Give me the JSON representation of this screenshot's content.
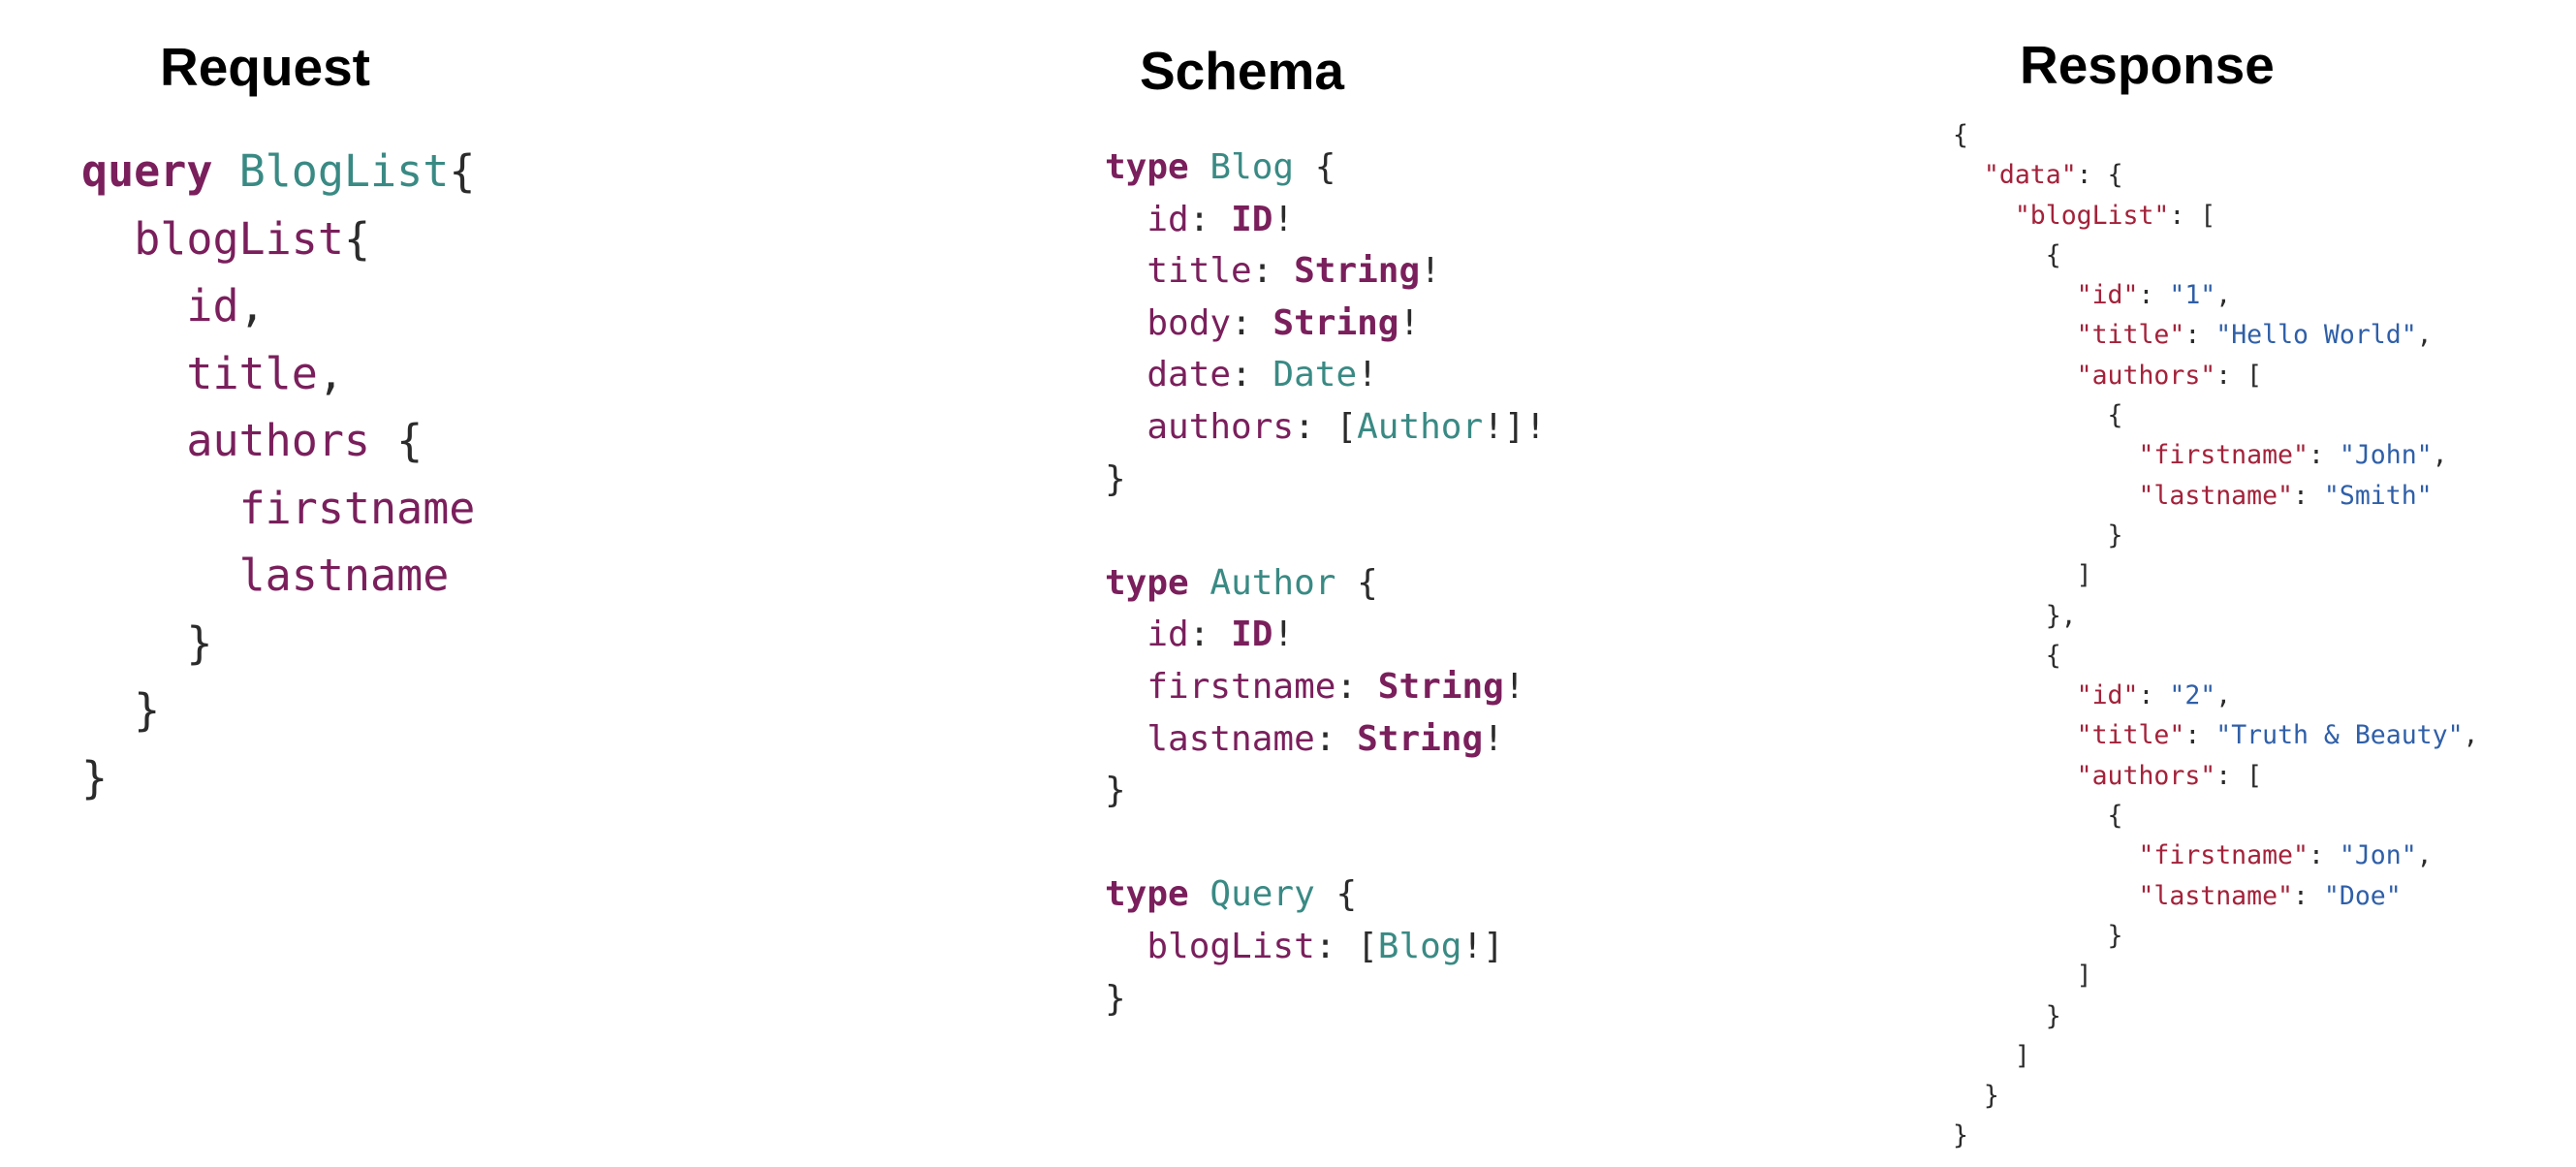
{
  "colors": {
    "keyword": "#7a1f5c",
    "type_name": "#3a8a84",
    "field": "#7a1f5c",
    "punctuation": "#2b2b2b",
    "json_key": "#a3223a",
    "json_string": "#2f5fa8",
    "title_text": "#000000"
  },
  "panels": [
    {
      "name": "request",
      "title": "Request",
      "lines": [
        [
          {
            "t": "query",
            "c": "keyword",
            "bold": true
          },
          {
            "t": " ",
            "c": "punctuation"
          },
          {
            "t": "BlogList",
            "c": "type_name"
          },
          {
            "t": "{",
            "c": "punctuation"
          }
        ],
        [
          {
            "t": "  ",
            "c": "punctuation"
          },
          {
            "t": "blogList",
            "c": "field"
          },
          {
            "t": "{",
            "c": "punctuation"
          }
        ],
        [
          {
            "t": "    ",
            "c": "punctuation"
          },
          {
            "t": "id",
            "c": "field"
          },
          {
            "t": ",",
            "c": "punctuation"
          }
        ],
        [
          {
            "t": "    ",
            "c": "punctuation"
          },
          {
            "t": "title",
            "c": "field"
          },
          {
            "t": ",",
            "c": "punctuation"
          }
        ],
        [
          {
            "t": "    ",
            "c": "punctuation"
          },
          {
            "t": "authors",
            "c": "field"
          },
          {
            "t": " {",
            "c": "punctuation"
          }
        ],
        [
          {
            "t": "      ",
            "c": "punctuation"
          },
          {
            "t": "firstname",
            "c": "field"
          }
        ],
        [
          {
            "t": "      ",
            "c": "punctuation"
          },
          {
            "t": "lastname",
            "c": "field"
          }
        ],
        [
          {
            "t": "    }",
            "c": "punctuation"
          }
        ],
        [
          {
            "t": "  }",
            "c": "punctuation"
          }
        ],
        [
          {
            "t": "}",
            "c": "punctuation"
          }
        ]
      ]
    },
    {
      "name": "schema",
      "title": "Schema",
      "lines": [
        [
          {
            "t": "type",
            "c": "keyword",
            "bold": true
          },
          {
            "t": " ",
            "c": "punctuation"
          },
          {
            "t": "Blog",
            "c": "type_name"
          },
          {
            "t": " {",
            "c": "punctuation"
          }
        ],
        [
          {
            "t": "  ",
            "c": "punctuation"
          },
          {
            "t": "id",
            "c": "field"
          },
          {
            "t": ": ",
            "c": "punctuation"
          },
          {
            "t": "ID",
            "c": "keyword",
            "bold": true
          },
          {
            "t": "!",
            "c": "punctuation"
          }
        ],
        [
          {
            "t": "  ",
            "c": "punctuation"
          },
          {
            "t": "title",
            "c": "field"
          },
          {
            "t": ": ",
            "c": "punctuation"
          },
          {
            "t": "String",
            "c": "keyword",
            "bold": true
          },
          {
            "t": "!",
            "c": "punctuation"
          }
        ],
        [
          {
            "t": "  ",
            "c": "punctuation"
          },
          {
            "t": "body",
            "c": "field"
          },
          {
            "t": ": ",
            "c": "punctuation"
          },
          {
            "t": "String",
            "c": "keyword",
            "bold": true
          },
          {
            "t": "!",
            "c": "punctuation"
          }
        ],
        [
          {
            "t": "  ",
            "c": "punctuation"
          },
          {
            "t": "date",
            "c": "field"
          },
          {
            "t": ": ",
            "c": "punctuation"
          },
          {
            "t": "Date",
            "c": "type_name"
          },
          {
            "t": "!",
            "c": "punctuation"
          }
        ],
        [
          {
            "t": "  ",
            "c": "punctuation"
          },
          {
            "t": "authors",
            "c": "field"
          },
          {
            "t": ": [",
            "c": "punctuation"
          },
          {
            "t": "Author",
            "c": "type_name"
          },
          {
            "t": "!]!",
            "c": "punctuation"
          }
        ],
        [
          {
            "t": "}",
            "c": "punctuation"
          }
        ],
        [
          {
            "t": "",
            "c": "punctuation"
          }
        ],
        [
          {
            "t": "type",
            "c": "keyword",
            "bold": true
          },
          {
            "t": " ",
            "c": "punctuation"
          },
          {
            "t": "Author",
            "c": "type_name"
          },
          {
            "t": " {",
            "c": "punctuation"
          }
        ],
        [
          {
            "t": "  ",
            "c": "punctuation"
          },
          {
            "t": "id",
            "c": "field"
          },
          {
            "t": ": ",
            "c": "punctuation"
          },
          {
            "t": "ID",
            "c": "keyword",
            "bold": true
          },
          {
            "t": "!",
            "c": "punctuation"
          }
        ],
        [
          {
            "t": "  ",
            "c": "punctuation"
          },
          {
            "t": "firstname",
            "c": "field"
          },
          {
            "t": ": ",
            "c": "punctuation"
          },
          {
            "t": "String",
            "c": "keyword",
            "bold": true
          },
          {
            "t": "!",
            "c": "punctuation"
          }
        ],
        [
          {
            "t": "  ",
            "c": "punctuation"
          },
          {
            "t": "lastname",
            "c": "field"
          },
          {
            "t": ": ",
            "c": "punctuation"
          },
          {
            "t": "String",
            "c": "keyword",
            "bold": true
          },
          {
            "t": "!",
            "c": "punctuation"
          }
        ],
        [
          {
            "t": "}",
            "c": "punctuation"
          }
        ],
        [
          {
            "t": "",
            "c": "punctuation"
          }
        ],
        [
          {
            "t": "type",
            "c": "keyword",
            "bold": true
          },
          {
            "t": " ",
            "c": "punctuation"
          },
          {
            "t": "Query",
            "c": "type_name"
          },
          {
            "t": " {",
            "c": "punctuation"
          }
        ],
        [
          {
            "t": "  ",
            "c": "punctuation"
          },
          {
            "t": "blogList",
            "c": "field"
          },
          {
            "t": ": [",
            "c": "punctuation"
          },
          {
            "t": "Blog",
            "c": "type_name"
          },
          {
            "t": "!]",
            "c": "punctuation"
          }
        ],
        [
          {
            "t": "}",
            "c": "punctuation"
          }
        ]
      ]
    },
    {
      "name": "response",
      "title": "Response",
      "lines": [
        [
          {
            "t": "{",
            "c": "punctuation"
          }
        ],
        [
          {
            "t": "  ",
            "c": "punctuation"
          },
          {
            "t": "\"data\"",
            "c": "json_key"
          },
          {
            "t": ": {",
            "c": "punctuation"
          }
        ],
        [
          {
            "t": "    ",
            "c": "punctuation"
          },
          {
            "t": "\"blogList\"",
            "c": "json_key"
          },
          {
            "t": ": [",
            "c": "punctuation"
          }
        ],
        [
          {
            "t": "      {",
            "c": "punctuation"
          }
        ],
        [
          {
            "t": "        ",
            "c": "punctuation"
          },
          {
            "t": "\"id\"",
            "c": "json_key"
          },
          {
            "t": ": ",
            "c": "punctuation"
          },
          {
            "t": "\"1\"",
            "c": "json_string"
          },
          {
            "t": ",",
            "c": "punctuation"
          }
        ],
        [
          {
            "t": "        ",
            "c": "punctuation"
          },
          {
            "t": "\"title\"",
            "c": "json_key"
          },
          {
            "t": ": ",
            "c": "punctuation"
          },
          {
            "t": "\"Hello World\"",
            "c": "json_string"
          },
          {
            "t": ",",
            "c": "punctuation"
          }
        ],
        [
          {
            "t": "        ",
            "c": "punctuation"
          },
          {
            "t": "\"authors\"",
            "c": "json_key"
          },
          {
            "t": ": [",
            "c": "punctuation"
          }
        ],
        [
          {
            "t": "          {",
            "c": "punctuation"
          }
        ],
        [
          {
            "t": "            ",
            "c": "punctuation"
          },
          {
            "t": "\"firstname\"",
            "c": "json_key"
          },
          {
            "t": ": ",
            "c": "punctuation"
          },
          {
            "t": "\"John\"",
            "c": "json_string"
          },
          {
            "t": ",",
            "c": "punctuation"
          }
        ],
        [
          {
            "t": "            ",
            "c": "punctuation"
          },
          {
            "t": "\"lastname\"",
            "c": "json_key"
          },
          {
            "t": ": ",
            "c": "punctuation"
          },
          {
            "t": "\"Smith\"",
            "c": "json_string"
          }
        ],
        [
          {
            "t": "          }",
            "c": "punctuation"
          }
        ],
        [
          {
            "t": "        ]",
            "c": "punctuation"
          }
        ],
        [
          {
            "t": "      },",
            "c": "punctuation"
          }
        ],
        [
          {
            "t": "      {",
            "c": "punctuation"
          }
        ],
        [
          {
            "t": "        ",
            "c": "punctuation"
          },
          {
            "t": "\"id\"",
            "c": "json_key"
          },
          {
            "t": ": ",
            "c": "punctuation"
          },
          {
            "t": "\"2\"",
            "c": "json_string"
          },
          {
            "t": ",",
            "c": "punctuation"
          }
        ],
        [
          {
            "t": "        ",
            "c": "punctuation"
          },
          {
            "t": "\"title\"",
            "c": "json_key"
          },
          {
            "t": ": ",
            "c": "punctuation"
          },
          {
            "t": "\"Truth & Beauty\"",
            "c": "json_string"
          },
          {
            "t": ",",
            "c": "punctuation"
          }
        ],
        [
          {
            "t": "        ",
            "c": "punctuation"
          },
          {
            "t": "\"authors\"",
            "c": "json_key"
          },
          {
            "t": ": [",
            "c": "punctuation"
          }
        ],
        [
          {
            "t": "          {",
            "c": "punctuation"
          }
        ],
        [
          {
            "t": "            ",
            "c": "punctuation"
          },
          {
            "t": "\"firstname\"",
            "c": "json_key"
          },
          {
            "t": ": ",
            "c": "punctuation"
          },
          {
            "t": "\"Jon\"",
            "c": "json_string"
          },
          {
            "t": ",",
            "c": "punctuation"
          }
        ],
        [
          {
            "t": "            ",
            "c": "punctuation"
          },
          {
            "t": "\"lastname\"",
            "c": "json_key"
          },
          {
            "t": ": ",
            "c": "punctuation"
          },
          {
            "t": "\"Doe\"",
            "c": "json_string"
          }
        ],
        [
          {
            "t": "          }",
            "c": "punctuation"
          }
        ],
        [
          {
            "t": "        ]",
            "c": "punctuation"
          }
        ],
        [
          {
            "t": "      }",
            "c": "punctuation"
          }
        ],
        [
          {
            "t": "    ]",
            "c": "punctuation"
          }
        ],
        [
          {
            "t": "  }",
            "c": "punctuation"
          }
        ],
        [
          {
            "t": "}",
            "c": "punctuation"
          }
        ]
      ]
    }
  ]
}
